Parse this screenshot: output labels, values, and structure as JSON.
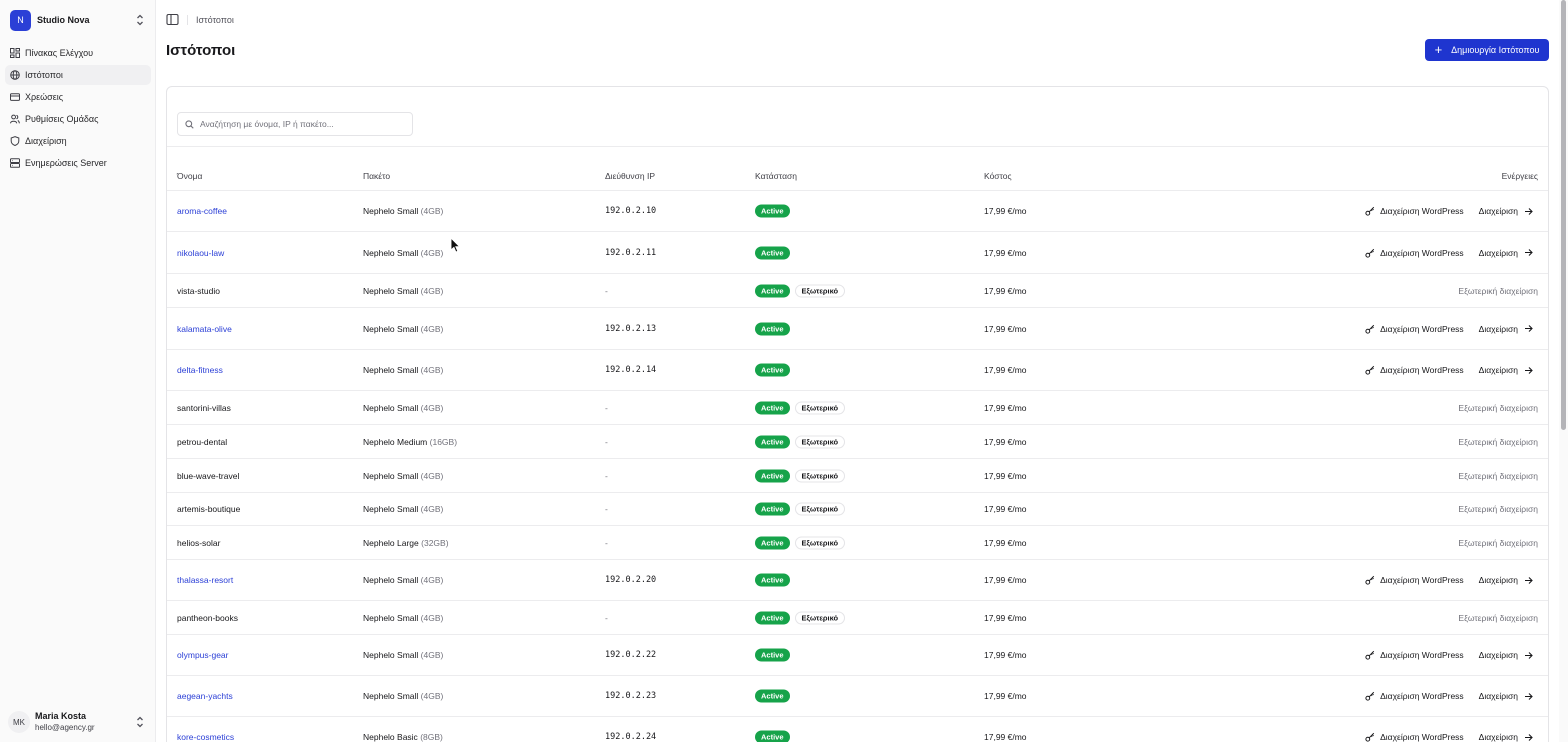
{
  "sidebar": {
    "org_initial": "N",
    "org_name": "Studio Nova",
    "items": [
      {
        "label": "Πίνακας Ελέγχου",
        "icon": "dashboard-icon"
      },
      {
        "label": "Ιστότοποι",
        "icon": "globe-icon",
        "active": true
      },
      {
        "label": "Χρεώσεις",
        "icon": "credit-card-icon"
      },
      {
        "label": "Ρυθμίσεις Ομάδας",
        "icon": "users-icon"
      },
      {
        "label": "Διαχείριση",
        "icon": "shield-icon"
      },
      {
        "label": "Ενημερώσεις Server",
        "icon": "server-icon"
      }
    ],
    "user": {
      "initials": "MK",
      "name": "Maria Kosta",
      "email": "hello@agency.gr"
    }
  },
  "header": {
    "breadcrumb": "Ιστότοποι",
    "title": "Ιστότοποι",
    "create_label": "Δημιουργία Ιστότοπου"
  },
  "search": {
    "placeholder": "Αναζήτηση με όνομα, IP ή πακέτο...",
    "value": ""
  },
  "table": {
    "columns": {
      "name": "Όνομα",
      "package": "Πακέτο",
      "ip": "Διεύθυνση IP",
      "status": "Κατάσταση",
      "cost": "Κόστος",
      "actions": "Ενέργειες"
    },
    "labels": {
      "active": "Active",
      "external": "Εξωτερικό",
      "manage_wp": "Διαχείριση WordPress",
      "manage": "Διαχείριση",
      "external_management": "Εξωτερική διαχείριση"
    },
    "rows": [
      {
        "name": "aroma-coffee",
        "plan": "Nephelo Small",
        "mem": "(4GB)",
        "ip": "192.0.2.10",
        "external": false,
        "cost": "17,99 €/mo"
      },
      {
        "name": "nikolaou-law",
        "plan": "Nephelo Small",
        "mem": "(4GB)",
        "ip": "192.0.2.11",
        "external": false,
        "cost": "17,99 €/mo"
      },
      {
        "name": "vista-studio",
        "plan": "Nephelo Small",
        "mem": "(4GB)",
        "ip": "-",
        "external": true,
        "cost": "17,99 €/mo"
      },
      {
        "name": "kalamata-olive",
        "plan": "Nephelo Small",
        "mem": "(4GB)",
        "ip": "192.0.2.13",
        "external": false,
        "cost": "17,99 €/mo"
      },
      {
        "name": "delta-fitness",
        "plan": "Nephelo Small",
        "mem": "(4GB)",
        "ip": "192.0.2.14",
        "external": false,
        "cost": "17,99 €/mo"
      },
      {
        "name": "santorini-villas",
        "plan": "Nephelo Small",
        "mem": "(4GB)",
        "ip": "-",
        "external": true,
        "cost": "17,99 €/mo"
      },
      {
        "name": "petrou-dental",
        "plan": "Nephelo Medium",
        "mem": "(16GB)",
        "ip": "-",
        "external": true,
        "cost": "17,99 €/mo"
      },
      {
        "name": "blue-wave-travel",
        "plan": "Nephelo Small",
        "mem": "(4GB)",
        "ip": "-",
        "external": true,
        "cost": "17,99 €/mo"
      },
      {
        "name": "artemis-boutique",
        "plan": "Nephelo Small",
        "mem": "(4GB)",
        "ip": "-",
        "external": true,
        "cost": "17,99 €/mo"
      },
      {
        "name": "helios-solar",
        "plan": "Nephelo Large",
        "mem": "(32GB)",
        "ip": "-",
        "external": true,
        "cost": "17,99 €/mo"
      },
      {
        "name": "thalassa-resort",
        "plan": "Nephelo Small",
        "mem": "(4GB)",
        "ip": "192.0.2.20",
        "external": false,
        "cost": "17,99 €/mo"
      },
      {
        "name": "pantheon-books",
        "plan": "Nephelo Small",
        "mem": "(4GB)",
        "ip": "-",
        "external": true,
        "cost": "17,99 €/mo"
      },
      {
        "name": "olympus-gear",
        "plan": "Nephelo Small",
        "mem": "(4GB)",
        "ip": "192.0.2.22",
        "external": false,
        "cost": "17,99 €/mo"
      },
      {
        "name": "aegean-yachts",
        "plan": "Nephelo Small",
        "mem": "(4GB)",
        "ip": "192.0.2.23",
        "external": false,
        "cost": "17,99 €/mo"
      },
      {
        "name": "kore-cosmetics",
        "plan": "Nephelo Basic",
        "mem": "(8GB)",
        "ip": "192.0.2.24",
        "external": false,
        "cost": "17,99 €/mo"
      }
    ]
  },
  "colors": {
    "accent": "#1f35cf",
    "link": "#2b3fd6",
    "active_badge": "#16a34a"
  }
}
